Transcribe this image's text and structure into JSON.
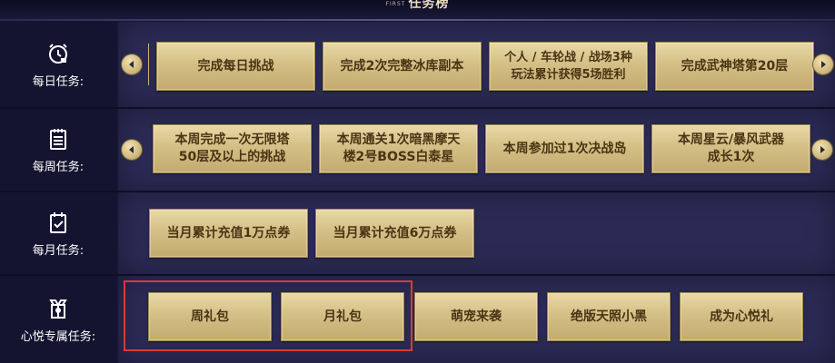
{
  "header": {
    "title_small": "FIRST",
    "title": "任务榜"
  },
  "rows": {
    "daily": {
      "label": "每日任务:",
      "icon": "alarm-clock-icon",
      "buttons": [
        "完成每日挑战",
        "完成2次完整冰库副本",
        "个人 / 车轮战 / 战场3种",
        "玩法累计获得5场胜利",
        "完成武神塔第20层"
      ]
    },
    "weekly": {
      "label": "每周任务:",
      "icon": "clipboard-list-icon",
      "buttons": [
        "本周完成一次无限塔",
        "50层及以上的挑战",
        "本周通关1次暗黑摩天",
        "楼2号BOSS白泰星",
        "本周参加过1次决战岛",
        "本周星云/暴风武器",
        "成长1次"
      ]
    },
    "monthly": {
      "label": "每月任务:",
      "icon": "calendar-check-icon",
      "buttons": [
        "当月累计充值1万点券",
        "当月累计充值6万点券"
      ]
    },
    "exclusive": {
      "label": "心悦专属任务:",
      "icon": "gift-badge-icon",
      "buttons": [
        "周礼包",
        "月礼包",
        "萌宠来袭",
        "绝版天照小黑",
        "成为心悦礼"
      ]
    }
  },
  "colors": {
    "button_gold": "#d4bf86",
    "button_text": "#4a3414",
    "highlight": "#d93a3a",
    "panel": "#2b2a55"
  }
}
